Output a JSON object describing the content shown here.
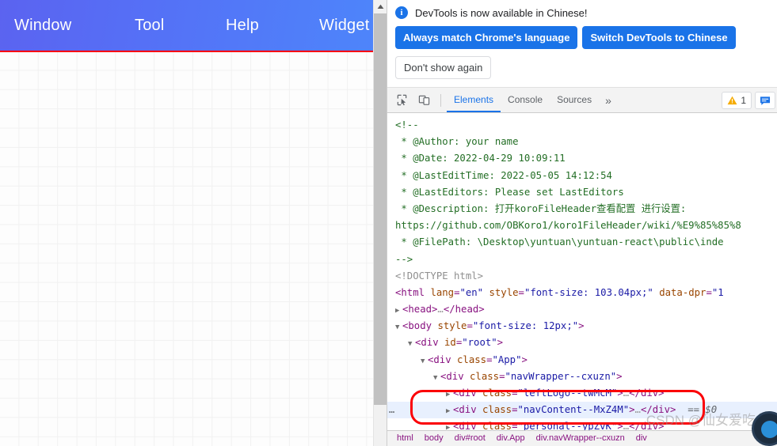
{
  "page": {
    "navbar": {
      "items": [
        {
          "label": "Window"
        },
        {
          "label": "Tool"
        },
        {
          "label": "Help"
        },
        {
          "label": "Widget"
        }
      ]
    }
  },
  "devtools": {
    "infobar": {
      "icon": "info-icon",
      "message": "DevTools is now available in Chinese!",
      "primary_buttons": [
        {
          "label": "Always match Chrome's language"
        },
        {
          "label": "Switch DevTools to Chinese"
        }
      ],
      "secondary_button": {
        "label": "Don't show again"
      }
    },
    "toolbar": {
      "inspect_icon": "inspect-element-icon",
      "device_icon": "device-toolbar-icon",
      "tabs": [
        {
          "label": "Elements",
          "active": true
        },
        {
          "label": "Console",
          "active": false
        },
        {
          "label": "Sources",
          "active": false
        }
      ],
      "more_tabs": "»",
      "warning_icon": "warning-triangle-icon",
      "warning_count": "1",
      "message_icon": "message-bubble-icon"
    },
    "elements": {
      "lines": [
        {
          "id": "l1",
          "type": "comment",
          "text": "<!--"
        },
        {
          "id": "l2",
          "type": "comment",
          "text": " * @Author: your name"
        },
        {
          "id": "l3",
          "type": "comment",
          "text": " * @Date: 2022-04-29 10:09:11"
        },
        {
          "id": "l4",
          "type": "comment",
          "text": " * @LastEditTime: 2022-05-05 14:12:54"
        },
        {
          "id": "l5",
          "type": "comment",
          "text": " * @LastEditors: Please set LastEditors"
        },
        {
          "id": "l6",
          "type": "comment",
          "text": " * @Description: 打开koroFileHeader查看配置 进行设置:"
        },
        {
          "id": "l7",
          "type": "comment",
          "text": "https://github.com/OBKoro1/koro1FileHeader/wiki/%E9%85%85%8"
        },
        {
          "id": "l8",
          "type": "comment",
          "text": " * @FilePath: \\Desktop\\yuntuan\\yuntuan-react\\public\\inde"
        },
        {
          "id": "l9",
          "type": "comment",
          "text": "-->"
        },
        {
          "id": "l10",
          "type": "doctype",
          "text": "<!DOCTYPE html>"
        }
      ],
      "html_tag": {
        "tag": "html",
        "attr1_name": "lang",
        "attr1_value": "\"en\"",
        "attr2_name": "style",
        "attr2_value": "\"font-size: 103.04px;\"",
        "attr3_name": "data-dpr",
        "attr3_value": "\"1"
      },
      "head_tag": {
        "open": "<head>",
        "dots": "…",
        "close": "</head>"
      },
      "body_tag": {
        "tag": "body",
        "attr_name": "style",
        "attr_value": "\"font-size: 12px;\""
      },
      "root_div": {
        "tag": "div",
        "attr_name": "id",
        "attr_value": "\"root\""
      },
      "app_div": {
        "tag": "div",
        "attr_name": "class",
        "attr_value": "\"App\""
      },
      "navwrapper_div": {
        "tag": "div",
        "attr_name": "class",
        "attr_value": "\"navWrapper--cxuzn\""
      },
      "leftlogo_div": {
        "tag": "div",
        "attr_name": "class",
        "attr_value": "\"leftLogo--twMcM\"",
        "dots": "…",
        "close": "</div>"
      },
      "navcontent_div": {
        "tag": "div",
        "attr_name": "class",
        "attr_value": "\"navContent--MxZ4M\"",
        "dots": "…",
        "close": "</div>",
        "selected_marker": "== $0",
        "overflow_dots": "…"
      },
      "personal_div": {
        "tag": "div",
        "attr_name": "class",
        "attr_value": "\"personal--ypZvK\"",
        "dots": "…",
        "close": "</div>"
      }
    },
    "breadcrumb": {
      "items": [
        "html",
        "body",
        "div#root",
        "div.App",
        "div.navWrapper--cxuzn",
        "div"
      ]
    }
  },
  "watermark": {
    "text": "CSDN @仙女爱吃鱼"
  },
  "colors": {
    "nav_gradient_start": "#5b63f0",
    "nav_gradient_end": "#4d86fb",
    "devtools_accent": "#1a73e8",
    "annotation_red": "#fb0007",
    "highlight_row": "#e8f0fe",
    "element_highlight_line": "#ff0000"
  }
}
